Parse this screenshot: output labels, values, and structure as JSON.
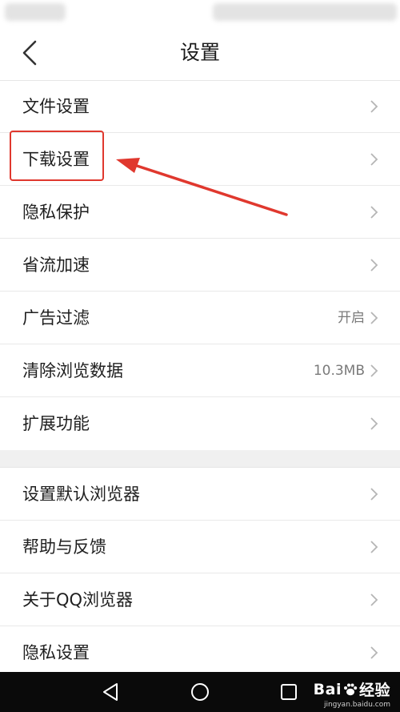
{
  "header": {
    "title": "设置"
  },
  "section1": [
    {
      "label": "文件设置",
      "value": ""
    },
    {
      "label": "下载设置",
      "value": ""
    },
    {
      "label": "隐私保护",
      "value": ""
    },
    {
      "label": "省流加速",
      "value": ""
    },
    {
      "label": "广告过滤",
      "value": "开启"
    },
    {
      "label": "清除浏览数据",
      "value": "10.3MB"
    },
    {
      "label": "扩展功能",
      "value": ""
    }
  ],
  "section2": [
    {
      "label": "设置默认浏览器",
      "value": ""
    },
    {
      "label": "帮助与反馈",
      "value": ""
    },
    {
      "label": "关于QQ浏览器",
      "value": ""
    },
    {
      "label": "隐私设置",
      "value": ""
    }
  ],
  "watermark": {
    "brand": "Bai",
    "brand_suffix": "经验",
    "url": "jingyan.baidu.com"
  },
  "icons": {
    "back": "chevron-left-icon",
    "row_arrow": "chevron-right-icon",
    "nav_back": "triangle-back-icon",
    "nav_home": "circle-home-icon",
    "nav_recent": "square-recent-icon",
    "paw": "paw-icon"
  },
  "colors": {
    "annotation": "#e0382e",
    "nav_bar": "#0a0a0a",
    "section_gap": "#f0f0f0"
  }
}
